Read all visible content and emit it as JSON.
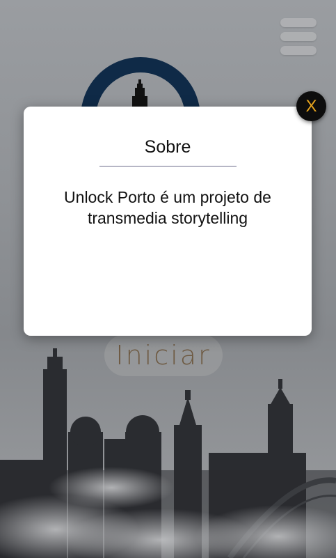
{
  "modal": {
    "title": "Sobre",
    "body": "Unlock Porto é um projeto de transmedia storytelling",
    "close_label": "X"
  },
  "start_button": {
    "label": "Iniciar"
  },
  "colors": {
    "modal_bg": "#ffffff",
    "close_bg": "#0d0d0d",
    "close_text": "#e8a51e",
    "logo_ring": "#0f2a47",
    "start_text": "#6e5a42"
  },
  "icons": {
    "menu": "hamburger-icon",
    "logo": "tower-logo-icon"
  }
}
